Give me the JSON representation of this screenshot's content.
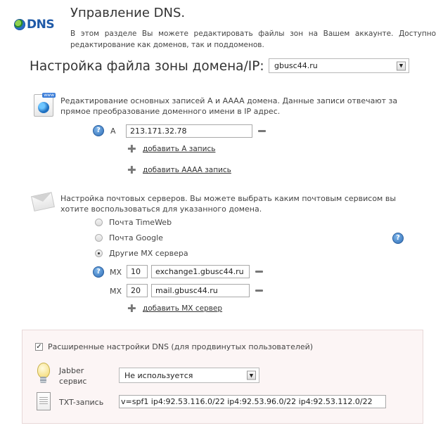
{
  "header": {
    "logo_text": "DNS",
    "title": "Управление DNS.",
    "description": "В этом разделе Вы можете редактировать файлы зон на Вашем аккаунте. Доступно редактирование как доменов, так и поддоменов."
  },
  "zone": {
    "label": "Настройка файла зоны домена/IP:",
    "selected_domain": "gbusc44.ru"
  },
  "records": {
    "description": "Редактирование основных записей A и AAAA домена. Данные записи отвечают за прямое преобразование доменного имени в IP адрес.",
    "a_label": "A",
    "a_value": "213.171.32.78",
    "add_a_link": "добавить A запись",
    "add_aaaa_link": "добавить AAAA запись"
  },
  "mail": {
    "description": "Настройка почтовых серверов. Вы можете выбрать каким почтовым сервисом вы хотите воспользоваться для указанного домена.",
    "options": [
      {
        "label": "Почта TimeWeb",
        "checked": false
      },
      {
        "label": "Почта Google",
        "checked": false
      },
      {
        "label": "Другие MX сервера",
        "checked": true
      }
    ],
    "mx_rows": [
      {
        "label": "MX",
        "priority": "10",
        "server": "exchange1.gbusc44.ru"
      },
      {
        "label": "MX",
        "priority": "20",
        "server": "mail.gbusc44.ru"
      }
    ],
    "add_mx_link": "добавить MX сервер"
  },
  "advanced": {
    "checkbox_label": "Расширенные настройки DNS (для продвинутых пользователей)",
    "checked": true,
    "jabber_label_line1": "Jabber",
    "jabber_label_line2": "сервис",
    "jabber_value": "Не используется",
    "txt_label": "TXT-запись",
    "txt_value": "v=spf1 ip4:92.53.116.0/22 ip4:92.53.96.0/22 ip4:92.53.112.0/22"
  }
}
